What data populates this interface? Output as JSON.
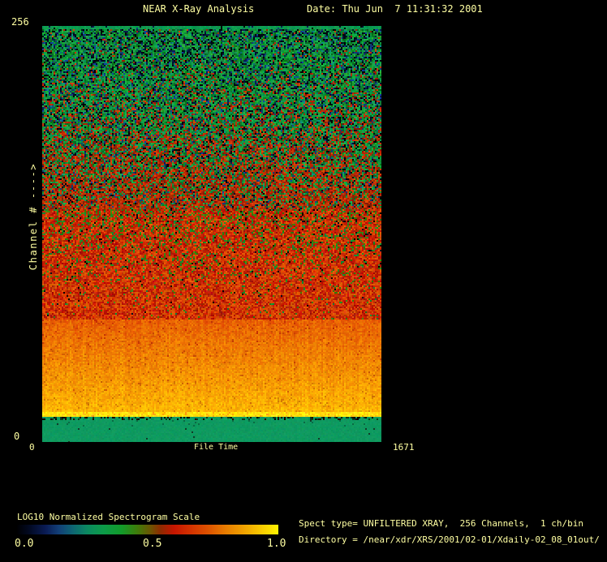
{
  "window": {
    "background": "#000000",
    "text_color": "#ffffa2"
  },
  "header": {
    "title": "NEAR X-Ray Analysis",
    "date_label": "Date: Thu Jun  7 11:31:32 2001"
  },
  "plot": {
    "y_axis": {
      "top_tick": "256",
      "bottom_tick": "0",
      "label": "Channel # ---->"
    },
    "x_axis": {
      "left_tick": "0",
      "right_tick": "1671",
      "label": "File Time"
    }
  },
  "colorbar": {
    "title": "LOG10 Normalized Spectrogram Scale",
    "ticks": [
      "0.0",
      "0.5",
      "1.0"
    ],
    "gradient": [
      {
        "pos": 0.0,
        "color": "#000002"
      },
      {
        "pos": 0.05,
        "color": "#020a24"
      },
      {
        "pos": 0.11,
        "color": "#0a1c55"
      },
      {
        "pos": 0.16,
        "color": "#123f77"
      },
      {
        "pos": 0.21,
        "color": "#0e6374"
      },
      {
        "pos": 0.27,
        "color": "#0b8a60"
      },
      {
        "pos": 0.33,
        "color": "#0c9b49"
      },
      {
        "pos": 0.4,
        "color": "#129b2a"
      },
      {
        "pos": 0.46,
        "color": "#3f7c0a"
      },
      {
        "pos": 0.51,
        "color": "#6b5602"
      },
      {
        "pos": 0.55,
        "color": "#8f2a00"
      },
      {
        "pos": 0.6,
        "color": "#c51500"
      },
      {
        "pos": 0.66,
        "color": "#d33000"
      },
      {
        "pos": 0.73,
        "color": "#dd5200"
      },
      {
        "pos": 0.8,
        "color": "#e87d00"
      },
      {
        "pos": 0.87,
        "color": "#f0a300"
      },
      {
        "pos": 0.93,
        "color": "#f8c800"
      },
      {
        "pos": 1.0,
        "color": "#fff200"
      }
    ]
  },
  "info": {
    "line1": "Spect type= UNFILTERED XRAY,  256 Channels,  1 ch/bin",
    "line2": "Directory = /near/xdr/XRS/2001/02-01/Xdaily-02_08_01out/"
  },
  "chart_data": {
    "type": "heatmap",
    "title": "NEAR X-Ray Analysis",
    "xlabel": "File Time",
    "ylabel": "Channel # ---->",
    "x_range": [
      0,
      1671
    ],
    "y_range": [
      0,
      256
    ],
    "scale_label": "LOG10 Normalized Spectrogram Scale",
    "scale_range": [
      0.0,
      1.0
    ],
    "legend_position": "bottom-left",
    "bands": [
      {
        "channels": [
          0,
          13
        ],
        "value": 0.33,
        "appearance": "uniform teal-green band across all times"
      },
      {
        "channels": [
          13,
          16
        ],
        "value": 0.95,
        "appearance": "thin bright yellow line"
      },
      {
        "channels": [
          16,
          62
        ],
        "value_range": [
          0.78,
          0.93
        ],
        "appearance": "bright orange band, brightening toward lower channels, vertical streak noise"
      },
      {
        "channels": [
          62,
          122
        ],
        "value_range": [
          0.58,
          0.7
        ],
        "appearance": "red speckled region with sparse green pixels"
      },
      {
        "channels": [
          122,
          200
        ],
        "value_range": [
          0.35,
          0.62
        ],
        "appearance": "green-red speckle mix, red fraction decreasing upward"
      },
      {
        "channels": [
          200,
          255
        ],
        "value_range": [
          0.0,
          0.45
        ],
        "appearance": "green noise with dark blue/black dropout speckles"
      },
      {
        "channels": [
          255,
          256
        ],
        "value": 0.33,
        "appearance": "thin uniform green line at top edge"
      }
    ],
    "notes": "Spectrogram values are essentially constant along the time axis (0-1671); structure is horizontal channel bands with per-pixel noise."
  },
  "spectrogram": {
    "seed": 1337,
    "block": 2,
    "zones": [
      {
        "name": "top-edge",
        "to": 0.008,
        "type": "solid",
        "color": "#0e9b52"
      },
      {
        "name": "green-noise",
        "to": 0.44,
        "type": "green_noise"
      },
      {
        "name": "red-noise",
        "to": 0.705,
        "type": "red_noise"
      },
      {
        "name": "orange-band",
        "to": 0.928,
        "type": "orange_band"
      },
      {
        "name": "yellow-line",
        "to": 0.94,
        "type": "yellow_line"
      },
      {
        "name": "boundary",
        "to": 0.948,
        "type": "boundary"
      },
      {
        "name": "bottom-band",
        "to": 1.0,
        "type": "solid_noise",
        "color": "#0f9a60"
      }
    ],
    "palettes": {
      "greens": [
        "#0d9b3f",
        "#0f8c2f",
        "#18a546",
        "#0a7a28",
        "#0c9b55",
        "#0a6a20",
        "#21a93c"
      ],
      "darks": [
        "#000000",
        "#00102e",
        "#0a1c50",
        "#02060f",
        "#123a78"
      ],
      "teals": [
        "#0a6a7a",
        "#0d8a8a",
        "#1040a0"
      ],
      "redSpecks": [
        "#b02400",
        "#c43000",
        "#8a2000",
        "#d24000"
      ],
      "redBase": [
        "#c41c00",
        "#d03200",
        "#b81800",
        "#dc4a00",
        "#ab1600",
        "#e05200",
        "#cc2800"
      ],
      "redGreens": [
        "#2d7a0e",
        "#3a8a12",
        "#0d8c33"
      ],
      "boundaryDark": [
        "#000000",
        "#0a3a20",
        "#1a0800"
      ],
      "bottomSpeck": "#0a6a44"
    }
  }
}
